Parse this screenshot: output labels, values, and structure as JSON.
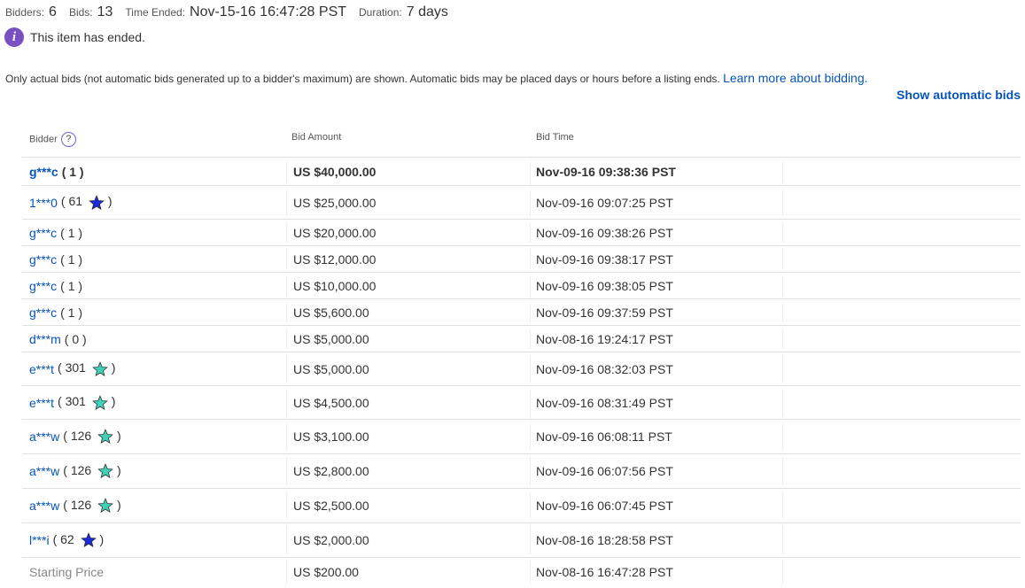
{
  "summary": {
    "bidders_label": "Bidders:",
    "bidders_value": "6",
    "bids_label": "Bids:",
    "bids_value": "13",
    "ended_label": "Time Ended:",
    "ended_value": "Nov-15-16 16:47:28 PST",
    "duration_label": "Duration:",
    "duration_value": "7 days"
  },
  "notice": {
    "icon": "info-icon",
    "text": "This item has ended."
  },
  "note": {
    "text": "Only actual bids (not automatic bids generated up to a bidder's maximum) are shown. Automatic bids may be placed days or hours before a listing ends.",
    "link": "Learn more about bidding."
  },
  "show_automatic_bids": "Show automatic bids",
  "headers": {
    "bidder": "Bidder",
    "amount": "Bid Amount",
    "time": "Bid Time",
    "help_icon": "question-icon"
  },
  "colors": {
    "link": "#0654ba",
    "star_blue": "#1b2bd6",
    "star_turquoise": "#3fd1b5",
    "info": "#7a4fc4"
  },
  "bids": [
    {
      "bidder": "g***c",
      "feedback": "1",
      "star": "",
      "amount": "US $40,000.00",
      "time": "Nov-09-16 09:38:36 PST"
    },
    {
      "bidder": "1***0",
      "feedback": "61",
      "star": "blue",
      "amount": "US $25,000.00",
      "time": "Nov-09-16 09:07:25 PST"
    },
    {
      "bidder": "g***c",
      "feedback": "1",
      "star": "",
      "amount": "US $20,000.00",
      "time": "Nov-09-16 09:38:26 PST"
    },
    {
      "bidder": "g***c",
      "feedback": "1",
      "star": "",
      "amount": "US $12,000.00",
      "time": "Nov-09-16 09:38:17 PST"
    },
    {
      "bidder": "g***c",
      "feedback": "1",
      "star": "",
      "amount": "US $10,000.00",
      "time": "Nov-09-16 09:38:05 PST"
    },
    {
      "bidder": "g***c",
      "feedback": "1",
      "star": "",
      "amount": "US $5,600.00",
      "time": "Nov-09-16 09:37:59 PST"
    },
    {
      "bidder": "d***m",
      "feedback": "0",
      "star": "",
      "amount": "US $5,000.00",
      "time": "Nov-08-16 19:24:17 PST"
    },
    {
      "bidder": "e***t",
      "feedback": "301",
      "star": "turquoise",
      "amount": "US $5,000.00",
      "time": "Nov-09-16 08:32:03 PST"
    },
    {
      "bidder": "e***t",
      "feedback": "301",
      "star": "turquoise",
      "amount": "US $4,500.00",
      "time": "Nov-09-16 08:31:49 PST"
    },
    {
      "bidder": "a***w",
      "feedback": "126",
      "star": "turquoise",
      "amount": "US $3,100.00",
      "time": "Nov-09-16 06:08:11 PST"
    },
    {
      "bidder": "a***w",
      "feedback": "126",
      "star": "turquoise",
      "amount": "US $2,800.00",
      "time": "Nov-09-16 06:07:56 PST"
    },
    {
      "bidder": "a***w",
      "feedback": "126",
      "star": "turquoise",
      "amount": "US $2,500.00",
      "time": "Nov-09-16 06:07:45 PST"
    },
    {
      "bidder": "l***i",
      "feedback": "62",
      "star": "blue",
      "amount": "US $2,000.00",
      "time": "Nov-08-16 18:28:58 PST"
    }
  ],
  "starting": {
    "label": "Starting Price",
    "amount": "US $200.00",
    "time": "Nov-08-16 16:47:28 PST"
  }
}
